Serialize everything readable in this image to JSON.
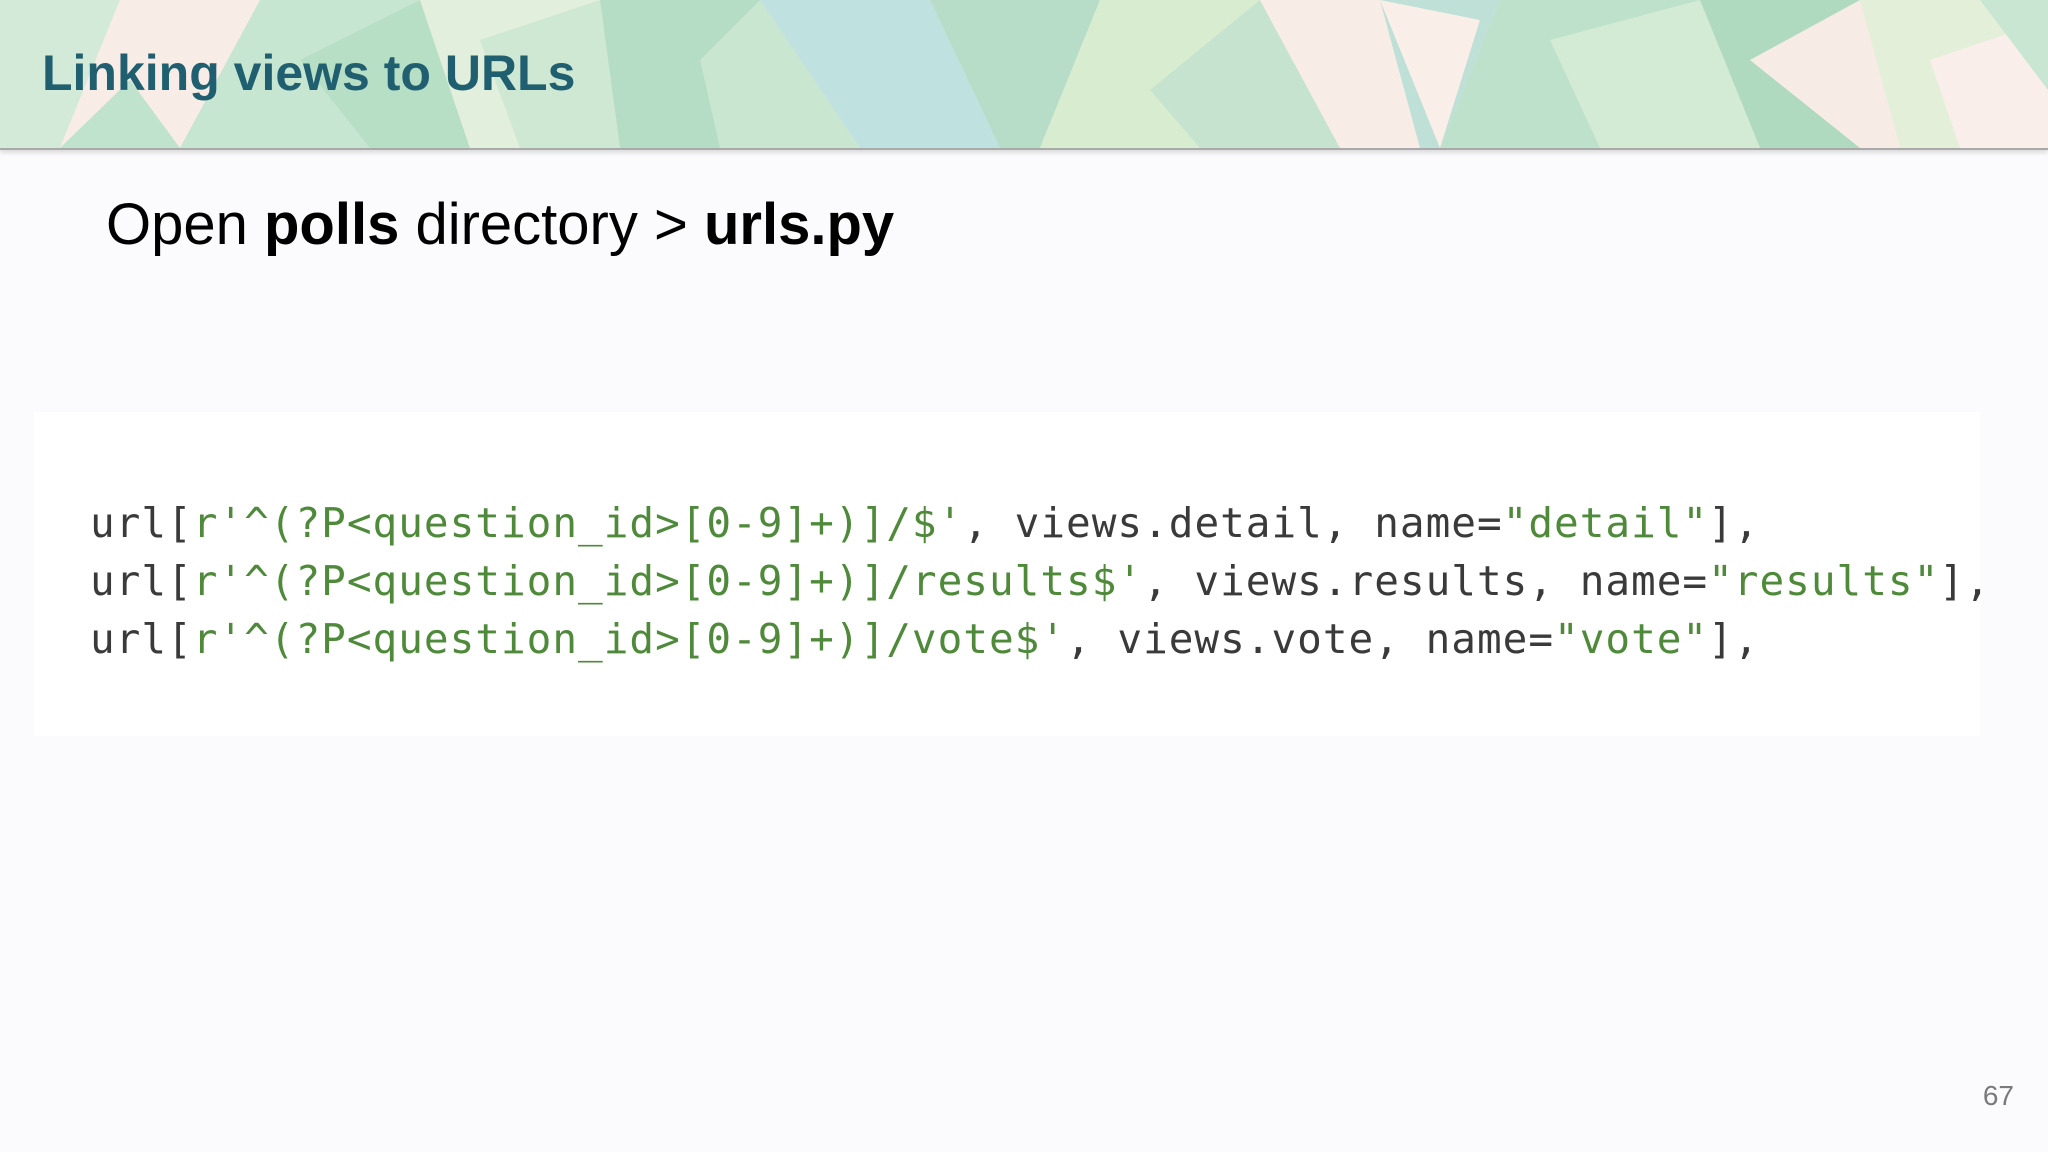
{
  "slide": {
    "title": "Linking views to URLs",
    "subtitle_parts": {
      "part1": "Open ",
      "part2_bold": "polls",
      "part3": " directory > ",
      "part4_bold": "urls.py"
    },
    "page_number": "67"
  },
  "code": {
    "lines": [
      {
        "prefix": "url[",
        "regex": "r'^(?P<question_id>[0-9]+)]/$'",
        "middle": ", views.detail, name=",
        "name": "\"detail\"",
        "suffix": "],"
      },
      {
        "prefix": "url[",
        "regex": "r'^(?P<question_id>[0-9]+)]/results$'",
        "middle": ", views.results, name=",
        "name": "\"results\"",
        "suffix": "],"
      },
      {
        "prefix": "url[",
        "regex": "r'^(?P<question_id>[0-9]+)]/vote$'",
        "middle": ", views.vote, name=",
        "name": "\"vote\"",
        "suffix": "],"
      }
    ]
  },
  "colors": {
    "title": "#1f5f70",
    "string": "#4e8a3a",
    "code_text": "#3a3a3a",
    "header_mint": "#b9e0c8",
    "header_cream": "#fbeee8",
    "header_blue": "#bcdfe0"
  }
}
